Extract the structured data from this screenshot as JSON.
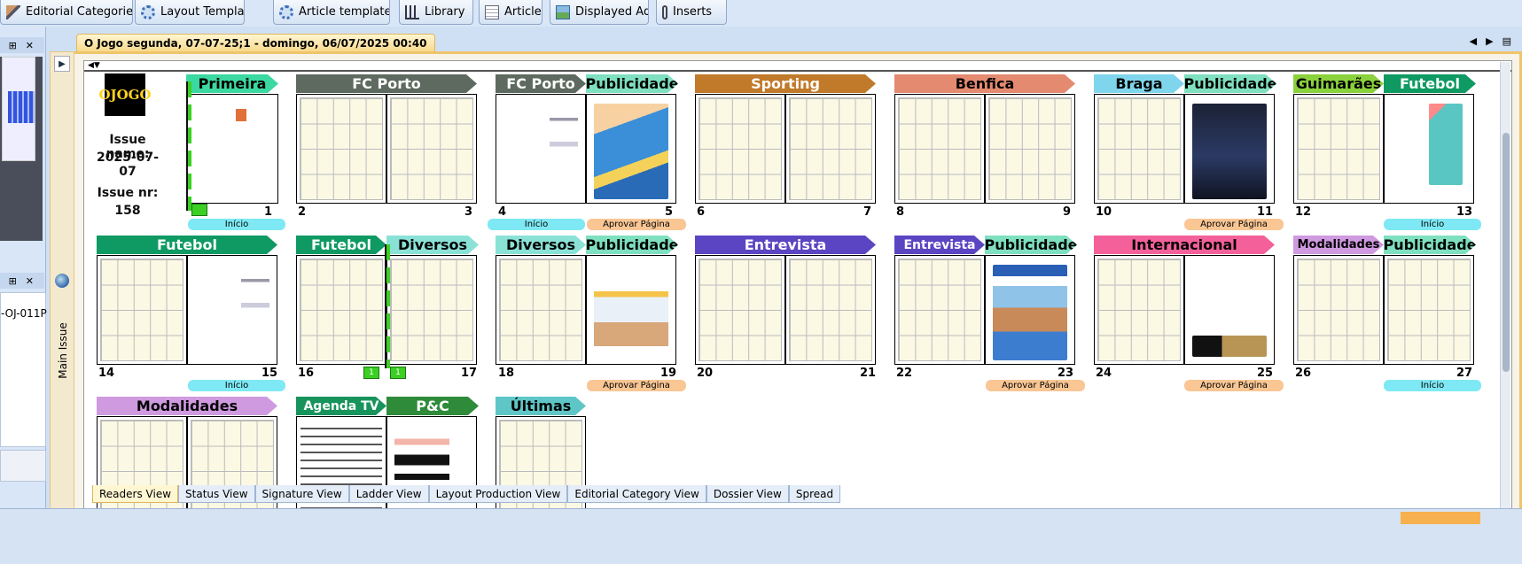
{
  "toolbar": {
    "tabs": [
      {
        "label": "Editorial Categories",
        "icon": "brush-icon"
      },
      {
        "label": "Layout Templates",
        "icon": "gear-icon"
      },
      {
        "label": "Article templates",
        "icon": "gear-icon"
      },
      {
        "label": "Library",
        "icon": "library-icon"
      },
      {
        "label": "Article",
        "icon": "document-icon"
      },
      {
        "label": "Displayed Ads",
        "icon": "image-icon"
      },
      {
        "label": "Inserts",
        "icon": "clip-icon"
      }
    ]
  },
  "left_panel": {
    "pin": "⊞",
    "close": "✕",
    "list_item": "-OJ-011P"
  },
  "issue_tab": {
    "title": "O Jogo  segunda, 07-07-25;1 - domingo, 06/07/2025 00:40"
  },
  "side": {
    "vertical_label": "Main Issue"
  },
  "issue": {
    "logo_text": "OJOGO",
    "name_label": "Issue name:",
    "name_value": "2025-07-07",
    "nr_label": "Issue nr:",
    "nr_value": "158"
  },
  "colors": {
    "primeira": "#3bd9a1",
    "fcporto": "#5e6a60",
    "publicidade": "#7ee0c0",
    "sporting": "#c07a2a",
    "benfica": "#e48a70",
    "braga": "#7fd6ec",
    "guimaraes": "#8ad13c",
    "futebol": "#0f9a63",
    "diversos": "#8ae2d7",
    "entrevista": "#5b45c2",
    "internacional": "#f4609a",
    "modalidades": "#cf9ae0",
    "agendatv": "#17945c",
    "pc": "#2e8b3a",
    "ultimas": "#5ec6c6"
  },
  "status": {
    "inicio": "Início",
    "aprovar": "Aprovar Página"
  },
  "pages": {
    "p1": "1",
    "p2": "2",
    "p3": "3",
    "p4": "4",
    "p5": "5",
    "p6": "6",
    "p7": "7",
    "p8": "8",
    "p9": "9",
    "p10": "10",
    "p11": "11",
    "p12": "12",
    "p13": "13",
    "p14": "14",
    "p15": "15",
    "p16": "16",
    "p17": "17",
    "p18": "18",
    "p19": "19",
    "p20": "20",
    "p21": "21",
    "p22": "22",
    "p23": "23",
    "p24": "24",
    "p25": "25",
    "p26": "26",
    "p27": "27",
    "g16": "1",
    "g17": "1"
  },
  "sections": {
    "primeira": "Primeira",
    "fcporto": "FC Porto",
    "publicidade": "Publicidade",
    "sporting": "Sporting",
    "benfica": "Benfica",
    "braga": "Braga",
    "guimaraes": "Guimarães",
    "futebol": "Futebol",
    "diversos": "Diversos",
    "entrevista": "Entrevista",
    "internacional": "Internacional",
    "modalidades": "Modalidades",
    "agendatv": "Agenda TV",
    "pc": "P&C",
    "ultimas": "Últimas"
  },
  "bottom_tabs": [
    "Readers View",
    "Status View",
    "Signature View",
    "Ladder View",
    "Layout Production View",
    "Editorial Category View",
    "Dossier View",
    "Spread"
  ],
  "nav": {
    "prev": "◀",
    "next": "▶",
    "menu": "▤",
    "collapse": "◀▼"
  }
}
